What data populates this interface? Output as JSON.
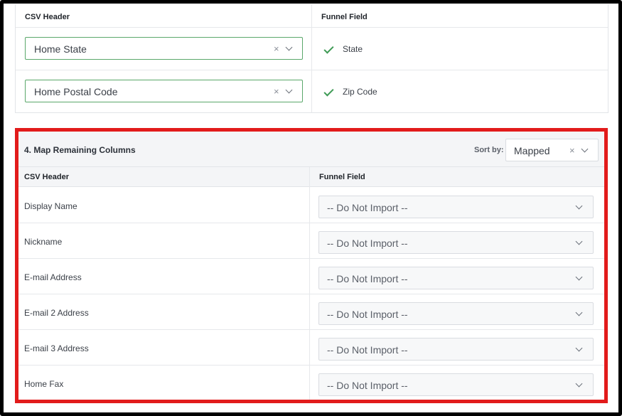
{
  "top_table": {
    "header_csv": "CSV Header",
    "header_funnel": "Funnel Field",
    "rows": [
      {
        "csv_value": "Home State",
        "funnel_field": "State"
      },
      {
        "csv_value": "Home Postal Code",
        "funnel_field": "Zip Code"
      }
    ]
  },
  "remaining": {
    "title": "4. Map Remaining Columns",
    "sort_label": "Sort by:",
    "sort_value": "Mapped",
    "header_csv": "CSV Header",
    "header_funnel": "Funnel Field",
    "rows": [
      {
        "csv_header": "Display Name",
        "funnel_value": "-- Do Not Import --"
      },
      {
        "csv_header": "Nickname",
        "funnel_value": "-- Do Not Import --"
      },
      {
        "csv_header": "E-mail Address",
        "funnel_value": "-- Do Not Import --"
      },
      {
        "csv_header": "E-mail 2 Address",
        "funnel_value": "-- Do Not Import --"
      },
      {
        "csv_header": "E-mail 3 Address",
        "funnel_value": "-- Do Not Import --"
      },
      {
        "csv_header": "Home Fax",
        "funnel_value": "-- Do Not Import --"
      }
    ]
  },
  "colors": {
    "highlight": "#e21b1b",
    "mapped_border": "#5aa86a",
    "check": "#3f9b56"
  }
}
